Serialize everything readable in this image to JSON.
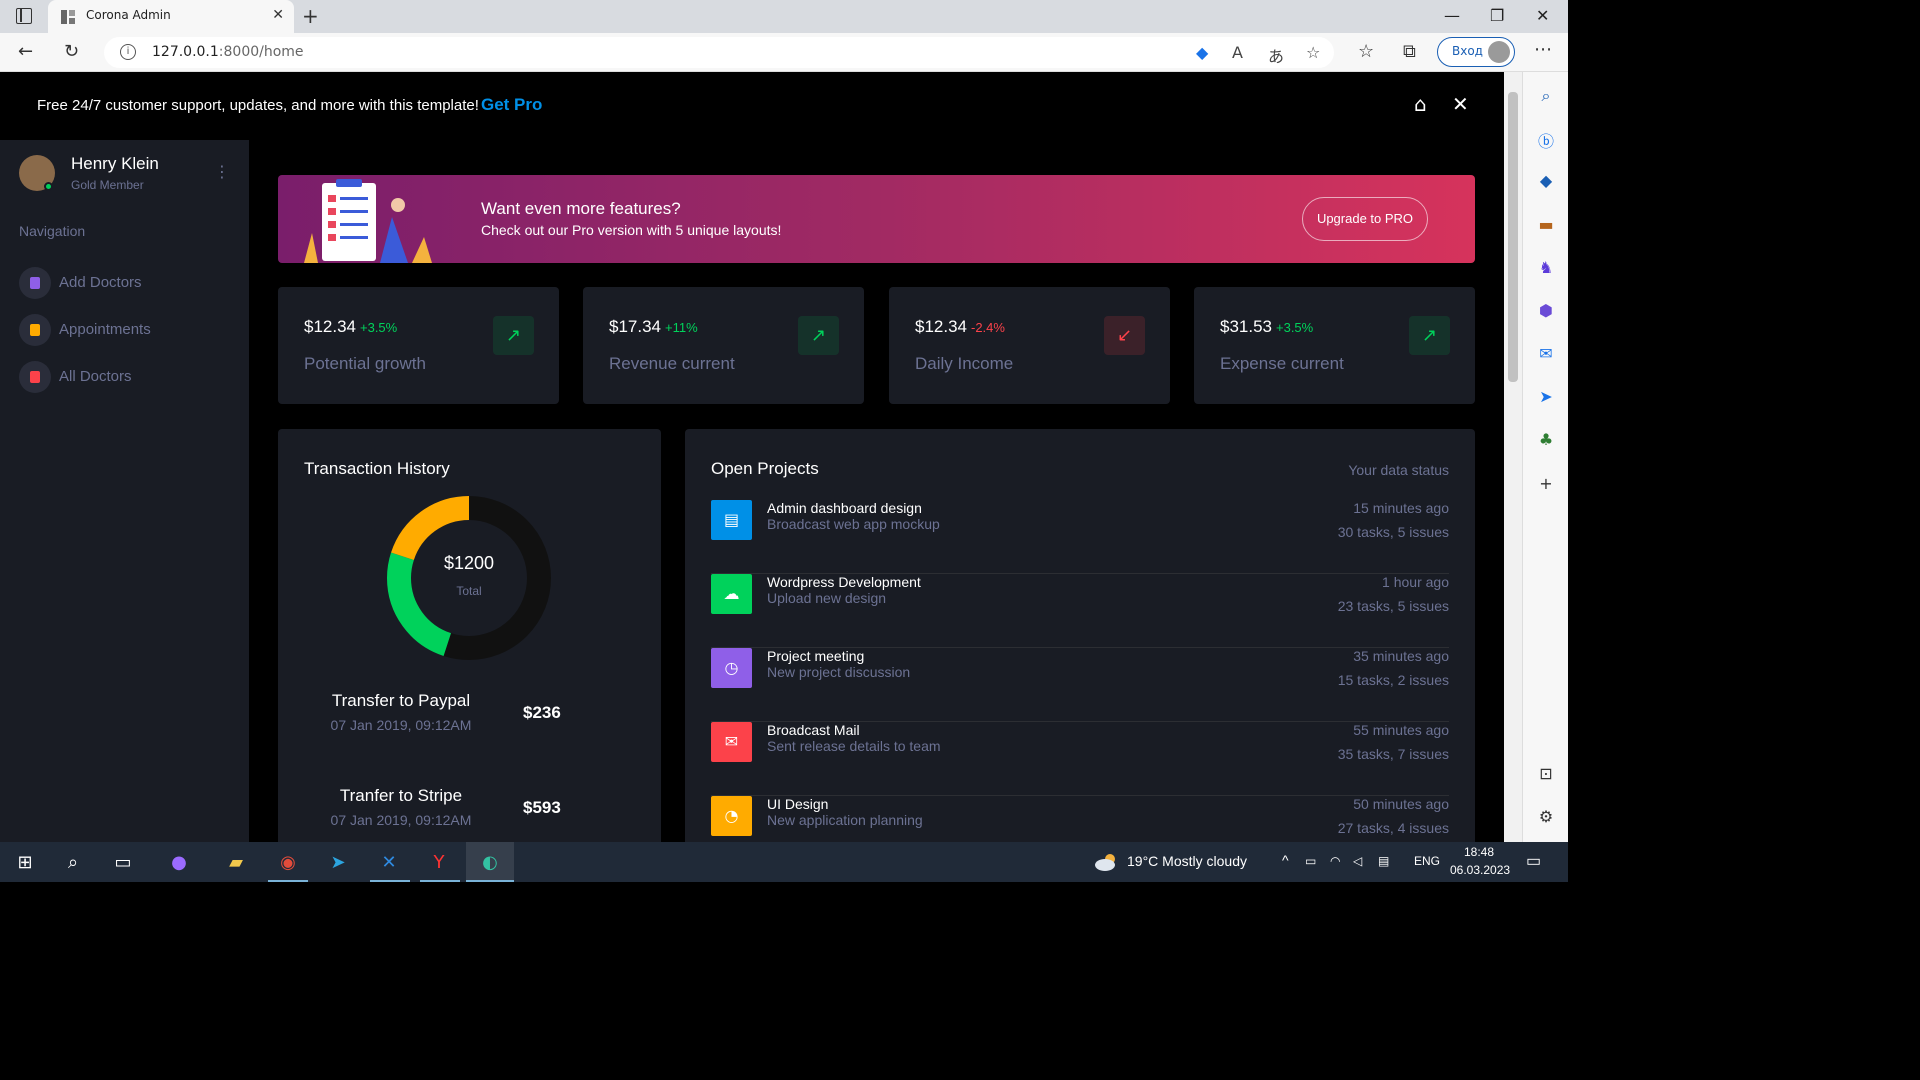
{
  "browser": {
    "tab_title": "Corona Admin",
    "url_host": "127.0.0.1",
    "url_path": ":8000/home",
    "login_label": "Вход"
  },
  "promo": {
    "text": "Free 24/7 customer support, updates, and more with this template!",
    "link": "Get Pro"
  },
  "profile": {
    "name": "Henry Klein",
    "role": "Gold Member"
  },
  "sidebar": {
    "heading": "Navigation",
    "items": [
      {
        "label": "Add Doctors",
        "color": "#8f5fe8"
      },
      {
        "label": "Appointments",
        "color": "#ffab00"
      },
      {
        "label": "All Doctors",
        "color": "#fc424a"
      }
    ]
  },
  "banner": {
    "title": "Want even more features?",
    "subtitle": "Check out our Pro version with 5 unique layouts!",
    "button": "Upgrade to PRO"
  },
  "stats": [
    {
      "value": "$12.34",
      "change": "+3.5%",
      "trend": "up",
      "label": "Potential growth"
    },
    {
      "value": "$17.34",
      "change": "+11%",
      "trend": "up",
      "label": "Revenue current"
    },
    {
      "value": "$12.34",
      "change": "-2.4%",
      "trend": "down",
      "label": "Daily Income"
    },
    {
      "value": "$31.53",
      "change": "+3.5%",
      "trend": "up",
      "label": "Expense current"
    }
  ],
  "transactions": {
    "title": "Transaction History",
    "total": "$1200",
    "total_label": "Total",
    "donut_segments": [
      {
        "color": "#111111",
        "fraction": 0.55
      },
      {
        "color": "#00d25b",
        "fraction": 0.25
      },
      {
        "color": "#ffab00",
        "fraction": 0.2
      }
    ],
    "rows": [
      {
        "name": "Transfer to Paypal",
        "date": "07 Jan 2019, 09:12AM",
        "amount": "$236"
      },
      {
        "name": "Tranfer to Stripe",
        "date": "07 Jan 2019, 09:12AM",
        "amount": "$593"
      }
    ]
  },
  "projects": {
    "title": "Open Projects",
    "status": "Your data status",
    "rows": [
      {
        "title": "Admin dashboard design",
        "subtitle": "Broadcast web app mockup",
        "time": "15 minutes ago",
        "tasks": "30 tasks, 5 issues",
        "color": "#0090e7",
        "icon": "file-icon"
      },
      {
        "title": "Wordpress Development",
        "subtitle": "Upload new design",
        "time": "1 hour ago",
        "tasks": "23 tasks, 5 issues",
        "color": "#00d25b",
        "icon": "cloud-download-icon"
      },
      {
        "title": "Project meeting",
        "subtitle": "New project discussion",
        "time": "35 minutes ago",
        "tasks": "15 tasks, 2 issues",
        "color": "#8f5fe8",
        "icon": "clock-icon"
      },
      {
        "title": "Broadcast Mail",
        "subtitle": "Sent release details to team",
        "time": "55 minutes ago",
        "tasks": "35 tasks, 7 issues",
        "color": "#fc424a",
        "icon": "mail-icon"
      },
      {
        "title": "UI Design",
        "subtitle": "New application planning",
        "time": "50 minutes ago",
        "tasks": "27 tasks, 4 issues",
        "color": "#ffab00",
        "icon": "chart-pie-icon"
      }
    ]
  },
  "taskbar": {
    "weather": "19°C  Mostly cloudy",
    "lang": "ENG",
    "time": "18:48",
    "date": "06.03.2023"
  }
}
